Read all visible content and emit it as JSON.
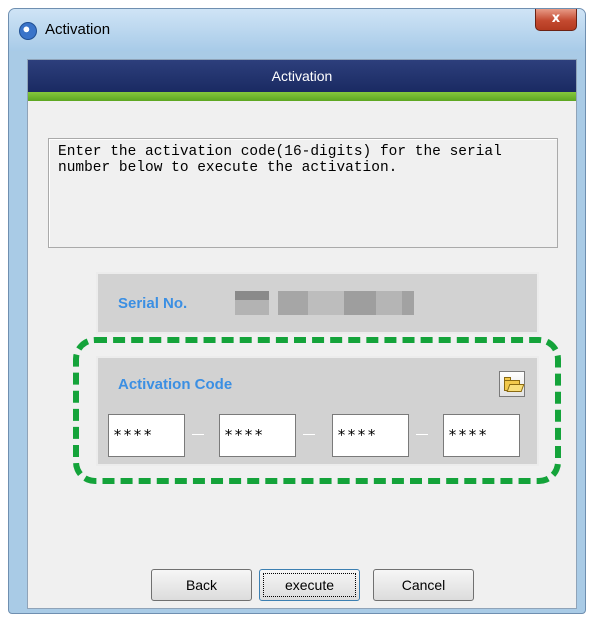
{
  "window": {
    "title": "Activation",
    "close_glyph": "x"
  },
  "header": {
    "title": "Activation",
    "colors": {
      "header": "#22346f",
      "accent_bar": "#74b832"
    }
  },
  "instructions": {
    "text": "Enter the activation code(16-digits) for the serial number below to execute the activation."
  },
  "serial": {
    "label": "Serial No.",
    "value_obscured": true
  },
  "activation_code": {
    "label": "Activation Code",
    "folder_icon": "open-folder-icon",
    "fields": [
      "****",
      "****",
      "****",
      "****"
    ],
    "separator": "-"
  },
  "highlight": {
    "color": "#14a33a",
    "style": "dashed"
  },
  "buttons": {
    "back": "Back",
    "execute": "execute",
    "cancel": "Cancel"
  }
}
